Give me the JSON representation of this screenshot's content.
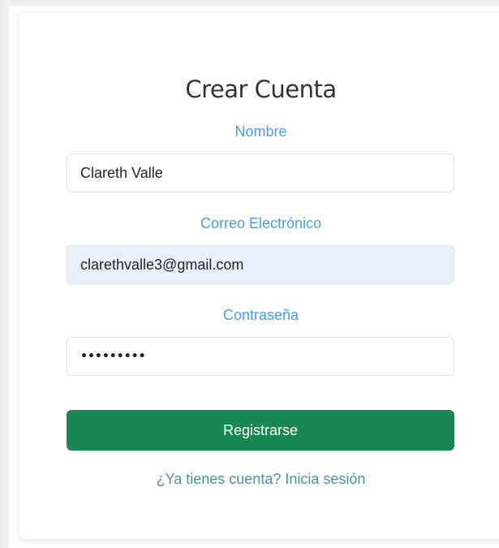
{
  "form": {
    "title": "Crear Cuenta",
    "name_label": "Nombre",
    "name_value": "Clareth Valle",
    "email_label": "Correo Electrónico",
    "email_value": "clarethvalle3@gmail.com",
    "password_label": "Contraseña",
    "password_value": "•••••••••",
    "submit_label": "Registrarse",
    "login_link": "¿Ya tienes cuenta? Inicia sesión"
  },
  "colors": {
    "label": "#4a9be6",
    "button": "#198754",
    "link": "#4b8fa5",
    "autofill_background": "#e8f0fe"
  }
}
